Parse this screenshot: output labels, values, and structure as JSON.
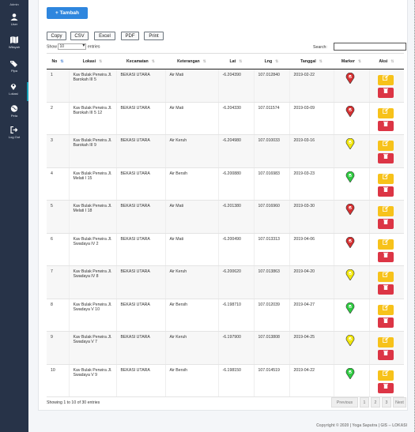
{
  "sidebar": {
    "user_label": "Admin",
    "items": [
      {
        "label": "User",
        "icon": "user-icon"
      },
      {
        "label": "Wilayah",
        "icon": "map-icon"
      },
      {
        "label": "Pipa",
        "icon": "tags-icon"
      },
      {
        "label": "Lokasi",
        "icon": "map-marker-icon"
      },
      {
        "label": "Peta",
        "icon": "globe-icon"
      },
      {
        "label": "Log Out",
        "icon": "sign-out-icon"
      }
    ]
  },
  "toolbar": {
    "add_label": "+ Tambah",
    "export_buttons": [
      "Copy",
      "CSV",
      "Excel",
      "PDF",
      "Print"
    ]
  },
  "table_controls": {
    "show_label": "Show",
    "entries_value": "10",
    "entries_label": "entries",
    "search_label": "Search:"
  },
  "table": {
    "headers": [
      "No",
      "Lokasi",
      "Kecamatan",
      "Keterangan",
      "Lat",
      "Lng",
      "Tanggal",
      "Marker",
      "Aksi"
    ],
    "rows": [
      {
        "no": "1",
        "lokasi": "Kav Bulak Perwira Jl. Barokah III 5",
        "kecamatan": "BEKASI UTARA",
        "keterangan": "Air Mati",
        "lat": "-6.204390",
        "lng": "107.012840",
        "tanggal": "2019-02-22",
        "marker": "red"
      },
      {
        "no": "2",
        "lokasi": "Kav Bulak Perwira Jl. Barokah III 5 12",
        "kecamatan": "BEKASI UTARA",
        "keterangan": "Air Mati",
        "lat": "-6.204330",
        "lng": "107.011574",
        "tanggal": "2019-03-09",
        "marker": "red"
      },
      {
        "no": "3",
        "lokasi": "Kav Bulak Perwira Jl. Barokah III 9",
        "kecamatan": "BEKASI UTARA",
        "keterangan": "Air Keruh",
        "lat": "-6.204980",
        "lng": "107.010033",
        "tanggal": "2019-03-16",
        "marker": "yellow"
      },
      {
        "no": "4",
        "lokasi": "Kav Bulak Perwira Jl. Melati I 15",
        "kecamatan": "BEKASI UTARA",
        "keterangan": "Air Bersih",
        "lat": "-6.200880",
        "lng": "107.016983",
        "tanggal": "2019-03-23",
        "marker": "green"
      },
      {
        "no": "5",
        "lokasi": "Kav Bulak Perwira Jl. Melati I 18",
        "kecamatan": "BEKASI UTARA",
        "keterangan": "Air Mati",
        "lat": "-6.201380",
        "lng": "107.016960",
        "tanggal": "2019-03-30",
        "marker": "red"
      },
      {
        "no": "6",
        "lokasi": "Kav Bulak Perwira Jl. Swadaya IV 2",
        "kecamatan": "BEKASI UTARA",
        "keterangan": "Air Mati",
        "lat": "-6.200490",
        "lng": "107.013313",
        "tanggal": "2019-04-06",
        "marker": "red"
      },
      {
        "no": "7",
        "lokasi": "Kav Bulak Perwira Jl. Swadaya IV 8",
        "kecamatan": "BEKASI UTARA",
        "keterangan": "Air Keruh",
        "lat": "-6.200620",
        "lng": "107.013863",
        "tanggal": "2019-04-20",
        "marker": "yellow"
      },
      {
        "no": "8",
        "lokasi": "Kav Bulak Perwira Jl. Swadaya V 10",
        "kecamatan": "BEKASI UTARA",
        "keterangan": "Air Bersih",
        "lat": "-6.198710",
        "lng": "107.012039",
        "tanggal": "2019-04-27",
        "marker": "green"
      },
      {
        "no": "9",
        "lokasi": "Kav Bulak Perwira Jl. Swadaya V 7",
        "kecamatan": "BEKASI UTARA",
        "keterangan": "Air Keruh",
        "lat": "-6.197900",
        "lng": "107.013808",
        "tanggal": "2019-04-25",
        "marker": "yellow"
      },
      {
        "no": "10",
        "lokasi": "Kav Bulak Perwira Jl. Swadaya V 9",
        "kecamatan": "BEKASI UTARA",
        "keterangan": "Air Bersih",
        "lat": "-6.198150",
        "lng": "107.014519",
        "tanggal": "2019-04-22",
        "marker": "green"
      }
    ]
  },
  "footer": {
    "info": "Showing 1 to 10 of 30 entries",
    "pagination": [
      "Previous",
      "1",
      "2",
      "3",
      "Next"
    ],
    "copyright": "Copyright © 2020 | Yoga Saputra | GIS -- LOKASI"
  },
  "colors": {
    "sidebar": "#273348",
    "primary": "#2e86de",
    "edit": "#f7c21a",
    "delete": "#dc3545",
    "marker_red": "#d63031",
    "marker_yellow": "#f1e60a",
    "marker_green": "#2ecc40"
  }
}
